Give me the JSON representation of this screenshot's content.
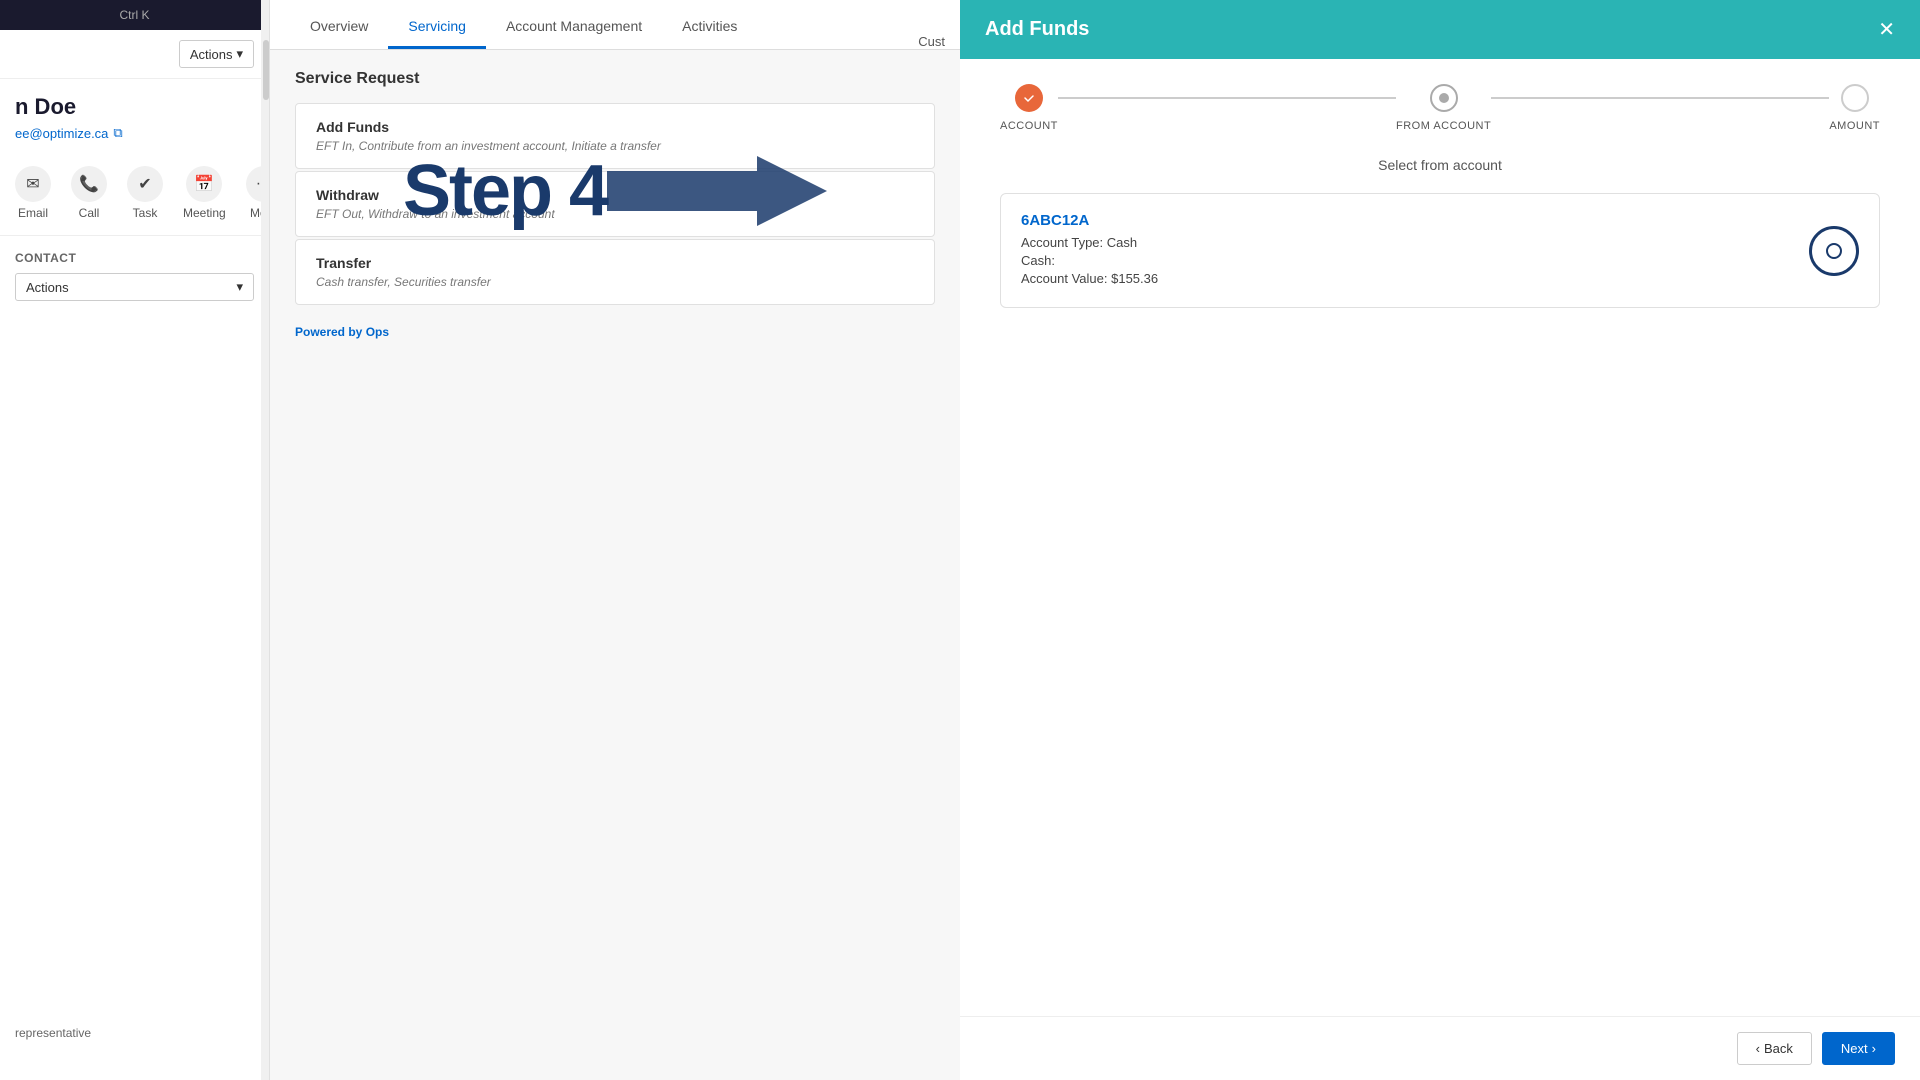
{
  "sidebar": {
    "topbar_text": "Ctrl K",
    "actions_label": "Actions",
    "contact_name": "n Doe",
    "contact_email": "ee@optimize.ca",
    "action_items": [
      {
        "id": "email",
        "icon": "✉",
        "label": "Email"
      },
      {
        "id": "call",
        "icon": "📞",
        "label": "Call"
      },
      {
        "id": "task",
        "icon": "✔",
        "label": "Task"
      },
      {
        "id": "meeting",
        "icon": "📅",
        "label": "Meeting"
      },
      {
        "id": "more",
        "icon": "···",
        "label": "More"
      }
    ],
    "contact_section_label": "Contact",
    "actions_dropdown_label": "Actions",
    "representative_label": "representative"
  },
  "main": {
    "tabs": [
      {
        "id": "overview",
        "label": "Overview",
        "active": false
      },
      {
        "id": "servicing",
        "label": "Servicing",
        "active": true
      },
      {
        "id": "account_management",
        "label": "Account Management",
        "active": false
      },
      {
        "id": "activities",
        "label": "Activities",
        "active": false
      }
    ],
    "cust_label": "Cust",
    "service_request": {
      "title": "Service Request",
      "cards": [
        {
          "id": "add_funds",
          "title": "Add Funds",
          "desc": "EFT In, Contribute from an investment account, Initiate a transfer"
        },
        {
          "id": "withdraw",
          "title": "Withdraw",
          "desc": "EFT Out, Withdraw to an investment account"
        },
        {
          "id": "transfer",
          "title": "Transfer",
          "desc": "Cash transfer, Securities transfer"
        }
      ],
      "powered_by_prefix": "Powered by ",
      "powered_by_brand": "Ops"
    },
    "step4_label": "Step 4"
  },
  "add_funds_panel": {
    "title": "Add Funds",
    "close_icon": "✕",
    "stepper": {
      "steps": [
        {
          "id": "account",
          "label": "ACCOUNT",
          "state": "completed"
        },
        {
          "id": "from_account",
          "label": "FROM ACCOUNT",
          "state": "active"
        },
        {
          "id": "amount",
          "label": "AMOUNT",
          "state": "inactive"
        }
      ]
    },
    "from_account_subtitle": "Select from account",
    "accounts": [
      {
        "id": "6ABC12A",
        "account_type_label": "Account Type:",
        "account_type_value": "Cash",
        "cash_label": "Cash:",
        "account_value_label": "Account Value:",
        "account_value": "$155.36"
      }
    ],
    "footer": {
      "back_label": "Back",
      "next_label": "Next"
    }
  }
}
